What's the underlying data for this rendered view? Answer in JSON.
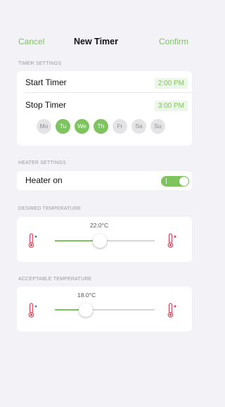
{
  "nav": {
    "cancel_label": "Cancel",
    "title": "New Timer",
    "confirm_label": "Confirm"
  },
  "timer_settings": {
    "header": "TIMER SETTINGS",
    "start_label": "Start Timer",
    "start_value": "2:00 PM",
    "stop_label": "Stop Timer",
    "stop_value": "3:00 PM",
    "days": [
      {
        "label": "Mo",
        "active": false
      },
      {
        "label": "Tu",
        "active": true
      },
      {
        "label": "We",
        "active": true
      },
      {
        "label": "Th",
        "active": true
      },
      {
        "label": "Fr",
        "active": false
      },
      {
        "label": "Sa",
        "active": false
      },
      {
        "label": "Su",
        "active": false
      }
    ]
  },
  "heater_settings": {
    "header": "HEATER SETTINGS",
    "heater_label": "Heater on",
    "heater_on": true
  },
  "desired_temperature": {
    "header": "DESIRED TEMPERATURE",
    "value_text": "22.0°C",
    "level": 0.45
  },
  "acceptable_temperature": {
    "header": "ACCEPTABLE TEMPERATURE",
    "value_text": "18.0°C",
    "level": 0.31
  },
  "colors": {
    "accent": "#7dc45f",
    "cold": "#3b8fe0",
    "hot": "#e0455b"
  },
  "icons": {
    "cold": "thermometer-cold-icon",
    "hot": "thermometer-hot-icon"
  }
}
